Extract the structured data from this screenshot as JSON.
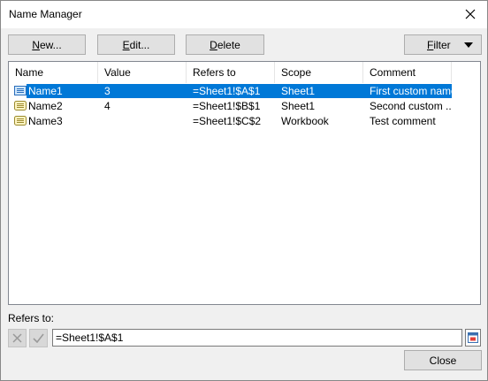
{
  "window": {
    "title": "Name Manager",
    "close_label": "×"
  },
  "toolbar": {
    "new_label_u": "N",
    "new_label_rest": "ew...",
    "edit_label_u": "E",
    "edit_label_rest": "dit...",
    "delete_label_u": "D",
    "delete_label_rest": "elete",
    "filter_label_u": "F",
    "filter_label_rest": "ilter"
  },
  "table": {
    "columns": [
      "Name",
      "Value",
      "Refers to",
      "Scope",
      "Comment"
    ],
    "rows": [
      {
        "name": "Name1",
        "value": "3",
        "refers_to": "=Sheet1!$A$1",
        "scope": "Sheet1",
        "comment": "First custom name",
        "selected": true
      },
      {
        "name": "Name2",
        "value": "4",
        "refers_to": "=Sheet1!$B$1",
        "scope": "Sheet1",
        "comment": "Second custom ...",
        "selected": false
      },
      {
        "name": "Name3",
        "value": "",
        "refers_to": "=Sheet1!$C$2",
        "scope": "Workbook",
        "comment": "Test comment",
        "selected": false
      }
    ]
  },
  "refers": {
    "label": "Refers to:",
    "value": "=Sheet1!$A$1"
  },
  "footer": {
    "close_label": "Close"
  },
  "colors": {
    "selection": "#0078d7",
    "button_face": "#e1e1e1"
  }
}
